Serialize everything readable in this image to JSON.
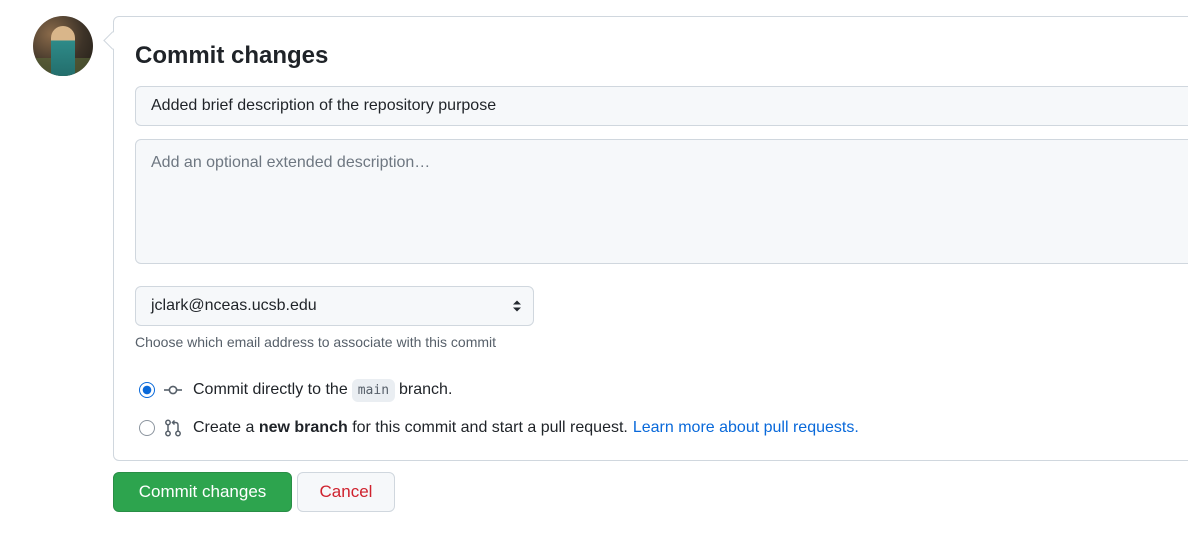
{
  "form": {
    "title": "Commit changes",
    "summary_value": "Added brief description of the repository purpose",
    "description_placeholder": "Add an optional extended description…",
    "email_selected": "jclark@nceas.ucsb.edu",
    "email_hint": "Choose which email address to associate with this commit"
  },
  "options": {
    "direct": {
      "prefix": "Commit directly to the",
      "branch": "main",
      "suffix": "branch.",
      "selected": true,
      "icon": "git-commit-icon"
    },
    "new_branch": {
      "prefix": "Create a",
      "bold": "new branch",
      "suffix": "for this commit and start a pull request.",
      "link": "Learn more about pull requests.",
      "selected": false,
      "icon": "git-pull-request-icon"
    }
  },
  "buttons": {
    "commit": "Commit changes",
    "cancel": "Cancel"
  },
  "colors": {
    "primary_green": "#2da44e",
    "link_blue": "#0969da",
    "danger_red": "#cf222e"
  }
}
